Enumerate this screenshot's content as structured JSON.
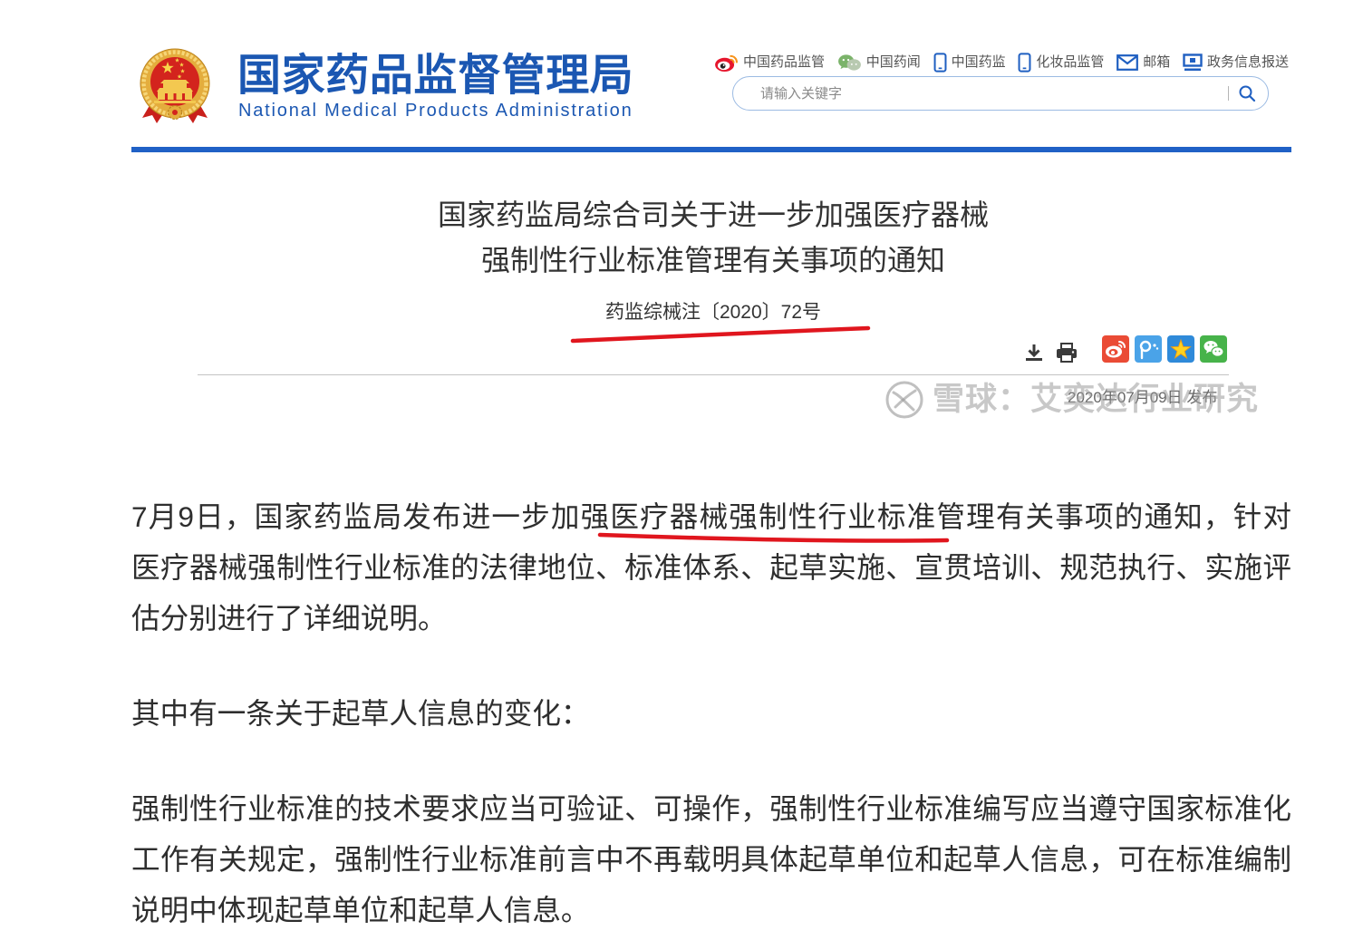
{
  "header": {
    "logo": {
      "icon": "national-emblem-icon",
      "name_cn": "国家药品监督管理局",
      "name_en": "National Medical Products Administration"
    },
    "links": [
      {
        "icon": "weibo-icon",
        "label": "中国药品监管"
      },
      {
        "icon": "wechat-icon",
        "label": "中国药闻"
      },
      {
        "icon": "mobile-phone-icon",
        "label": "中国药监"
      },
      {
        "icon": "mobile-phone-icon",
        "label": "化妆品监管"
      },
      {
        "icon": "mail-icon",
        "label": "邮箱"
      },
      {
        "icon": "monitor-icon",
        "label": "政务信息报送"
      }
    ],
    "search": {
      "placeholder": "请输入关键字",
      "button_icon": "search-icon"
    }
  },
  "notice": {
    "title_lines": [
      "国家药监局综合司关于进一步加强医疗器械",
      "强制性行业标准管理有关事项的通知"
    ],
    "doc_number": "药监综械注〔2020〕72号",
    "tools": [
      "download-icon",
      "print-icon"
    ],
    "share": [
      "weibo-share-icon",
      "tencent-weibo-share-icon",
      "qzone-share-icon",
      "wechat-share-icon"
    ],
    "publish_date": "2020年07月09日 发布"
  },
  "watermark": {
    "icon": "xueqiu-logo-icon",
    "text": "雪球：艾奕达行业研究"
  },
  "article": {
    "paragraphs": [
      {
        "lines": [
          "7月9日，国家药监局发布进一步加强医疗器械强制性行业标准管理有关事项的通知，针对",
          "医疗器械强制性行业标准的法律地位、标准体系、起草实施、宣贯培训、规范执行、实施评",
          "估分别进行了详细说明。"
        ]
      },
      {
        "lines": [
          "其中有一条关于起草人信息的变化："
        ]
      },
      {
        "lines": [
          "强制性行业标准的技术要求应当可验证、可操作，强制性行业标准编写应当遵守国家标准化",
          "工作有关规定，强制性行业标准前言中不再载明具体起草单位和起草人信息，可在标准编制",
          "说明中体现起草单位和起草人信息。"
        ]
      }
    ]
  },
  "colors": {
    "brand_blue": "#1b57b2",
    "rule_blue": "#2061c6",
    "body_text": "#2e2e2e",
    "annotation_red": "#e0161e",
    "divider_gray": "#c4c4c4"
  }
}
